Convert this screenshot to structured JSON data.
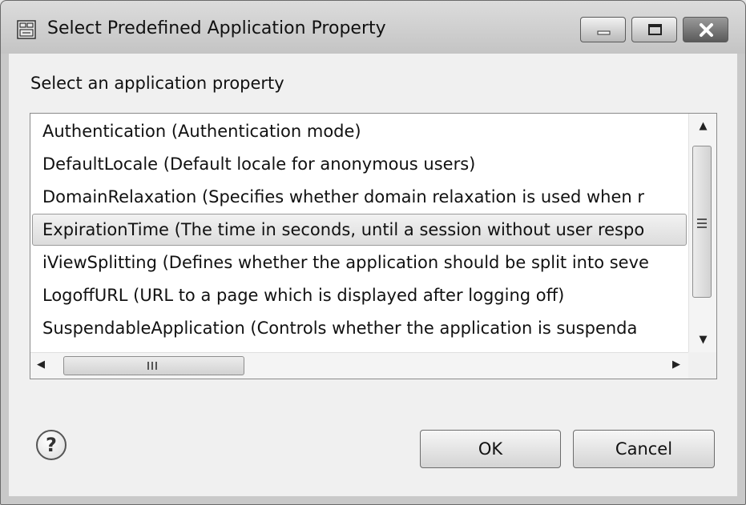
{
  "window": {
    "title": "Select Predefined Application Property"
  },
  "dialog": {
    "prompt": "Select an application property",
    "items": [
      {
        "label": "Authentication (Authentication mode)"
      },
      {
        "label": "DefaultLocale (Default locale for anonymous users)"
      },
      {
        "label": "DomainRelaxation (Specifies whether domain relaxation is used when r"
      },
      {
        "label": "ExpirationTime (The time in seconds, until a session without user respo"
      },
      {
        "label": "iViewSplitting (Defines whether the application should be split into seve"
      },
      {
        "label": "LogoffURL (URL to a page which is displayed after logging off)"
      },
      {
        "label": "SuspendableApplication (Controls whether the application is suspenda"
      }
    ],
    "selected_index": 3
  },
  "buttons": {
    "ok": "OK",
    "cancel": "Cancel",
    "help": "?"
  },
  "icons": {
    "app": "application-icon",
    "minimize": "minimize-icon",
    "maximize": "maximize-icon",
    "close": "close-icon",
    "help": "help-icon"
  }
}
